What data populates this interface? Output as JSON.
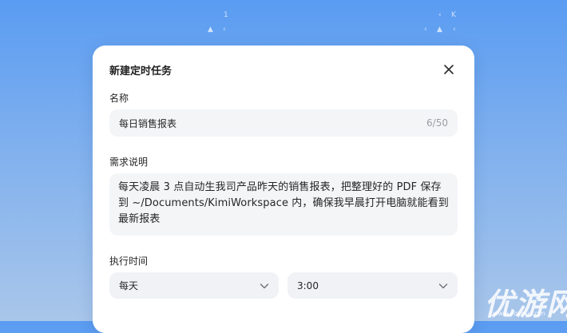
{
  "background": {
    "glyphs": [
      "1",
      "▲",
      "‹",
      "‹",
      "K",
      "‹",
      "▲",
      "‹"
    ]
  },
  "dialog": {
    "title": "新建定时任务",
    "name_label": "名称",
    "name_value": "每日销售报表",
    "name_counter": "6/50",
    "desc_label": "需求说明",
    "desc_value": "每天凌晨 3 点自动生我司产品昨天的销售报表，把整理好的 PDF 保存到 ~/Documents/KimiWorkspace 内，确保我早晨打开电脑就能看到最新报表",
    "time_label": "执行时间",
    "frequency_value": "每天",
    "time_value": "3:00"
  },
  "watermark": {
    "text": "优游网",
    "sub": "www.yoyou.com"
  },
  "colors": {
    "accent": "#5a9cf2",
    "dialog_bg": "#ffffff",
    "field_bg": "#f4f5f7"
  }
}
